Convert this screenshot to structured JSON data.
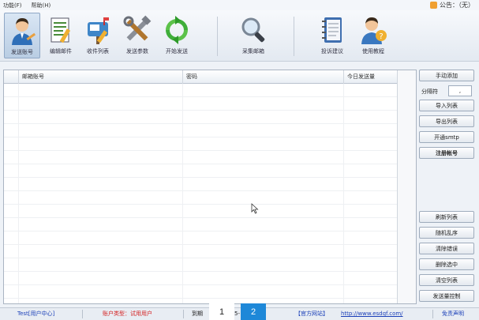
{
  "menu": {
    "items": [
      "功能(F)",
      "帮助(H)"
    ],
    "notice_label": "公告：（无）"
  },
  "toolbar": {
    "buttons": [
      {
        "label": "发送账号",
        "icon": "user-account-icon"
      },
      {
        "label": "编辑邮件",
        "icon": "edit-document-icon"
      },
      {
        "label": "收件列表",
        "icon": "mailbox-icon"
      },
      {
        "label": "发送参数",
        "icon": "tools-icon"
      },
      {
        "label": "开始发送",
        "icon": "refresh-send-icon"
      },
      {
        "label": "采集邮箱",
        "icon": "magnifier-icon"
      },
      {
        "label": "投诉建议",
        "icon": "notebook-icon"
      },
      {
        "label": "使用教程",
        "icon": "help-user-icon"
      }
    ]
  },
  "table": {
    "columns": [
      "邮箱账号",
      "密码",
      "今日发送量"
    ],
    "rows": []
  },
  "side": {
    "manual_add": "手动添加",
    "separator_label": "分隔符",
    "separator_value": ",",
    "import_list": "导入列表",
    "export_list": "导出列表",
    "enable_smtp": "开通smtp",
    "register_account": "注册帐号",
    "refresh_list": "刷新列表",
    "random_shuffle": "随机乱序",
    "clear_invalid": "清除错误",
    "delete_selected": "删除选中",
    "clear_list": "清空列表",
    "send_control": "发送量控制"
  },
  "status": {
    "user_center": "Test[用户中心]",
    "account_type": "账户类型：试用用户",
    "expiry_prefix": "到期",
    "expiry_partial": "5-",
    "official_site_label": "【官方网站】",
    "official_site_url": "http://www.esdqf.com/",
    "disclaimer": "免责声明"
  },
  "pager": {
    "page1": "1",
    "page2": "2"
  },
  "colors": {
    "accent_blue": "#1e88d8",
    "account_type_red": "#d42020",
    "link_blue": "#1a3fb8"
  }
}
